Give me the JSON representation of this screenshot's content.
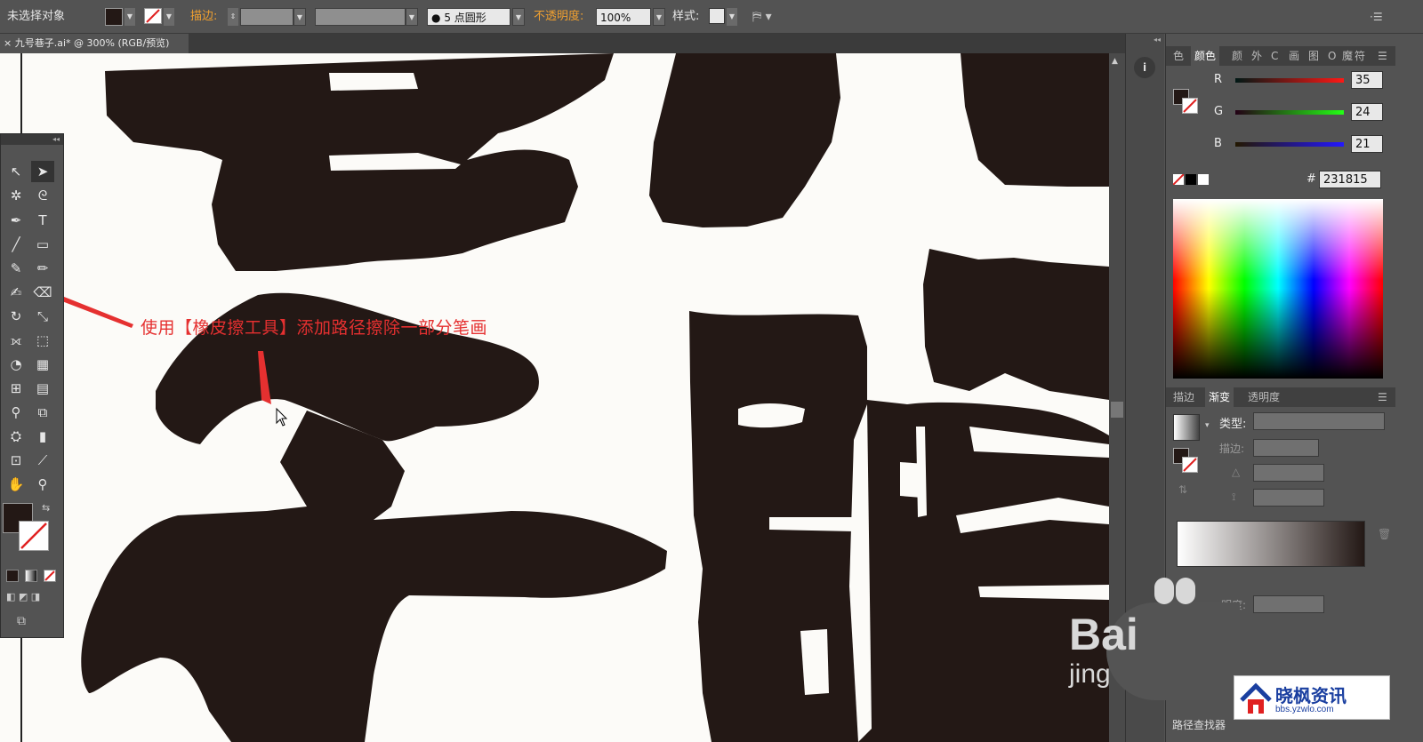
{
  "control_bar": {
    "selection_label": "未选择对象",
    "stroke_label": "描边:",
    "brush_label": "5 点圆形",
    "opacity_label": "不透明度:",
    "opacity_value": "100%",
    "style_label": "样式:",
    "fill_color": "#231815"
  },
  "document_tab": {
    "close_glyph": "×",
    "title": "九号巷子.ai* @ 300% (RGB/预览)"
  },
  "annotation": {
    "text": "使用【橡皮擦工具】添加路径擦除一部分笔画",
    "color": "#e53030"
  },
  "color_panel": {
    "tabs": [
      "色",
      "颜色",
      "颜",
      "外",
      "C",
      "画",
      "图",
      "O",
      "魔",
      "符"
    ],
    "r_label": "R",
    "r_value": "35",
    "g_label": "G",
    "g_value": "24",
    "b_label": "B",
    "b_value": "21",
    "hex_label": "#",
    "hex_value": "231815"
  },
  "gradient_panel": {
    "tabs": [
      "描边",
      "渐变",
      "透明度"
    ],
    "type_label": "类型:",
    "stroke_label": "描边:",
    "opacity_label": "明度:"
  },
  "bottom_panel_label": "路径查找器",
  "watermark": {
    "big": "Bai",
    "small": "jing"
  },
  "logo": {
    "title": "晓枫资讯",
    "url": "bbs.yzwlo.com"
  },
  "icons": {
    "info": "i"
  }
}
